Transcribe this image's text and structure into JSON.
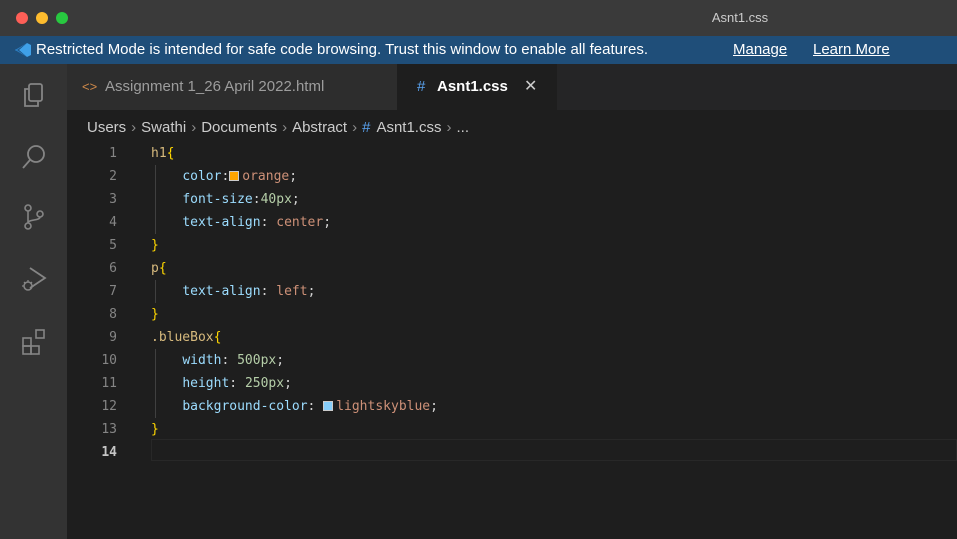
{
  "window": {
    "title": "Asnt1.css"
  },
  "banner": {
    "message": "Restricted Mode is intended for safe code browsing. Trust this window to enable all features.",
    "manage_label": "Manage",
    "learn_more_label": "Learn More"
  },
  "activity_bar": {
    "icons": [
      "explorer-icon",
      "search-icon",
      "source-control-icon",
      "run-debug-icon",
      "extensions-icon"
    ]
  },
  "tabs": [
    {
      "label": "Assignment 1_26 April 2022.html",
      "icon": "<>",
      "active": false
    },
    {
      "label": "Asnt1.css",
      "icon": "#",
      "active": true,
      "close": "✕"
    }
  ],
  "breadcrumb": {
    "items": [
      "Users",
      "Swathi",
      "Documents",
      "Abstract"
    ],
    "file_icon": "#",
    "file": "Asnt1.css",
    "more": "..."
  },
  "colors": {
    "orange_swatch": "#ffa500",
    "lightskyblue_swatch": "#87cefa",
    "banner_bg": "#1f4e79"
  },
  "editor": {
    "current_line": 14,
    "lines": [
      {
        "num": "1",
        "code": [
          [
            "selector",
            "h1"
          ],
          [
            "brace",
            "{"
          ]
        ]
      },
      {
        "num": "2",
        "code": [
          [
            "indent",
            "    "
          ],
          [
            "prop",
            "color"
          ],
          [
            "punct",
            ":"
          ],
          [
            "swatch",
            "orange"
          ],
          [
            "val",
            "orange"
          ],
          [
            "punct",
            ";"
          ]
        ]
      },
      {
        "num": "3",
        "code": [
          [
            "indent",
            "    "
          ],
          [
            "prop",
            "font-size"
          ],
          [
            "punct",
            ":"
          ],
          [
            "num",
            "40px"
          ],
          [
            "punct",
            ";"
          ]
        ]
      },
      {
        "num": "4",
        "code": [
          [
            "indent",
            "    "
          ],
          [
            "prop",
            "text-align"
          ],
          [
            "punct",
            ": "
          ],
          [
            "val",
            "center"
          ],
          [
            "punct",
            ";"
          ]
        ]
      },
      {
        "num": "5",
        "code": [
          [
            "brace",
            "}"
          ]
        ]
      },
      {
        "num": "6",
        "code": [
          [
            "selector",
            "p"
          ],
          [
            "brace",
            "{"
          ]
        ]
      },
      {
        "num": "7",
        "code": [
          [
            "indent",
            "    "
          ],
          [
            "prop",
            "text-align"
          ],
          [
            "punct",
            ": "
          ],
          [
            "val",
            "left"
          ],
          [
            "punct",
            ";"
          ]
        ]
      },
      {
        "num": "8",
        "code": [
          [
            "brace",
            "}"
          ]
        ]
      },
      {
        "num": "9",
        "code": [
          [
            "selector",
            ".blueBox"
          ],
          [
            "brace",
            "{"
          ]
        ]
      },
      {
        "num": "10",
        "code": [
          [
            "indent",
            "    "
          ],
          [
            "prop",
            "width"
          ],
          [
            "punct",
            ": "
          ],
          [
            "num",
            "500px"
          ],
          [
            "punct",
            ";"
          ]
        ]
      },
      {
        "num": "11",
        "code": [
          [
            "indent",
            "    "
          ],
          [
            "prop",
            "height"
          ],
          [
            "punct",
            ": "
          ],
          [
            "num",
            "250px"
          ],
          [
            "punct",
            ";"
          ]
        ]
      },
      {
        "num": "12",
        "code": [
          [
            "indent",
            "    "
          ],
          [
            "prop",
            "background-color"
          ],
          [
            "punct",
            ": "
          ],
          [
            "swatch",
            "lightskyblue"
          ],
          [
            "val",
            "lightskyblue"
          ],
          [
            "punct",
            ";"
          ]
        ]
      },
      {
        "num": "13",
        "code": [
          [
            "brace",
            "}"
          ]
        ]
      },
      {
        "num": "14",
        "code": []
      }
    ]
  }
}
